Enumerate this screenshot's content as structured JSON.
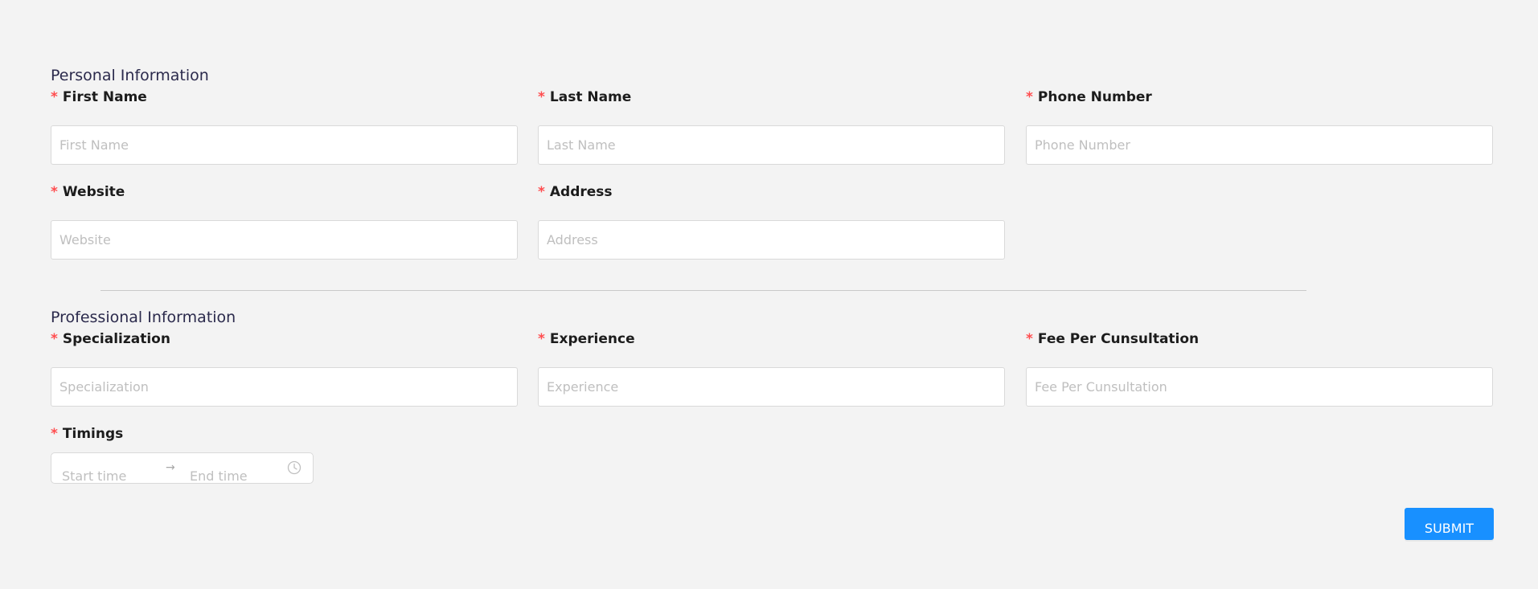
{
  "personal_section": {
    "title": "Personal Information",
    "fields": {
      "first_name": {
        "label": "First Name",
        "placeholder": "First Name",
        "value": ""
      },
      "last_name": {
        "label": "Last Name",
        "placeholder": "Last Name",
        "value": ""
      },
      "phone_number": {
        "label": "Phone Number",
        "placeholder": "Phone Number",
        "value": ""
      },
      "website": {
        "label": "Website",
        "placeholder": "Website",
        "value": ""
      },
      "address": {
        "label": "Address",
        "placeholder": "Address",
        "value": ""
      }
    }
  },
  "professional_section": {
    "title": "Professional Information",
    "fields": {
      "specialization": {
        "label": "Specialization",
        "placeholder": "Specialization",
        "value": ""
      },
      "experience": {
        "label": "Experience",
        "placeholder": "Experience",
        "value": ""
      },
      "fee": {
        "label": "Fee Per Cunsultation",
        "placeholder": "Fee Per Cunsultation",
        "value": ""
      },
      "timings": {
        "label": "Timings",
        "start_placeholder": "Start time",
        "end_placeholder": "End time",
        "separator": "→",
        "icon": "clock-icon"
      }
    }
  },
  "required_marker": "*",
  "submit": {
    "label": "SUBMIT"
  },
  "colors": {
    "background": "#f3f3f3",
    "required": "#ff4d4f",
    "primary": "#1890ff",
    "section_title": "#2b2a4c",
    "input_border": "#d9d9d9",
    "placeholder": "#bfbfbf"
  }
}
